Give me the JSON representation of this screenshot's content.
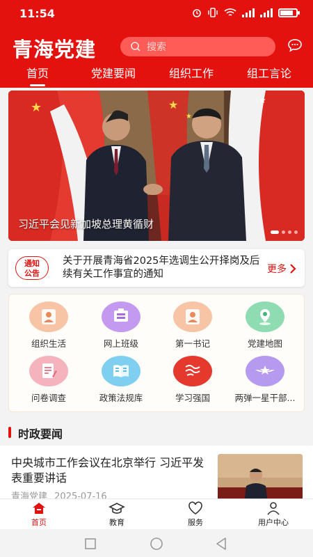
{
  "status": {
    "time": "11:54",
    "battery_level": 0.8,
    "icons": [
      "alarm-icon",
      "vibrate-icon",
      "wifi-icon",
      "signal-icon",
      "signal-icon",
      "battery-icon"
    ]
  },
  "header": {
    "logo": "青海党建",
    "search_placeholder": "搜索",
    "tabs": [
      {
        "label": "首页",
        "active": true
      },
      {
        "label": "党建要闻",
        "active": false
      },
      {
        "label": "组织工作",
        "active": false
      },
      {
        "label": "组工言论",
        "active": false
      }
    ]
  },
  "banner": {
    "caption": "习近平会见新加坡总理黄循财",
    "slide_count": 4,
    "current_slide": 1
  },
  "notice": {
    "badge": "通知\n公告",
    "badge_line1": "通知",
    "badge_line2": "公告",
    "text": "关于开展青海省2025年选调生公开择岗及后续有关工作事宜的通知",
    "more_label": "更多"
  },
  "grid": {
    "items": [
      {
        "label": "组织生活",
        "icon": "person-icon",
        "color": "#f6b08d"
      },
      {
        "label": "网上班级",
        "icon": "classroom-icon",
        "color": "#b27de6"
      },
      {
        "label": "第一书记",
        "icon": "person-icon",
        "color": "#f6b08d"
      },
      {
        "label": "党建地图",
        "icon": "map-pin-icon",
        "color": "#6ccf9a"
      },
      {
        "label": "问卷调查",
        "icon": "survey-icon",
        "color": "#f29aa8"
      },
      {
        "label": "政策法规库",
        "icon": "book-icon",
        "color": "#56c1ea"
      },
      {
        "label": "学习强国",
        "icon": "xuexi-logo-icon",
        "color": "#e5392d"
      },
      {
        "label": "两弹一星干部...",
        "icon": "wings-star-icon",
        "color": "#9c79e6"
      }
    ]
  },
  "section": {
    "title": "时政要闻"
  },
  "news": [
    {
      "title": "中央城市工作会议在北京举行 习近平发表重要讲话",
      "source": "青海党建",
      "date": "2025-07-16"
    }
  ],
  "bottom_nav": [
    {
      "label": "首页",
      "icon": "home-icon",
      "active": true
    },
    {
      "label": "教育",
      "icon": "graduation-cap-icon",
      "active": false
    },
    {
      "label": "服务",
      "icon": "heart-icon",
      "active": false
    },
    {
      "label": "用户中心",
      "icon": "user-icon",
      "active": false
    }
  ],
  "colors": {
    "brand_red": "#e4120f",
    "search_bg": "#ff5c58"
  }
}
